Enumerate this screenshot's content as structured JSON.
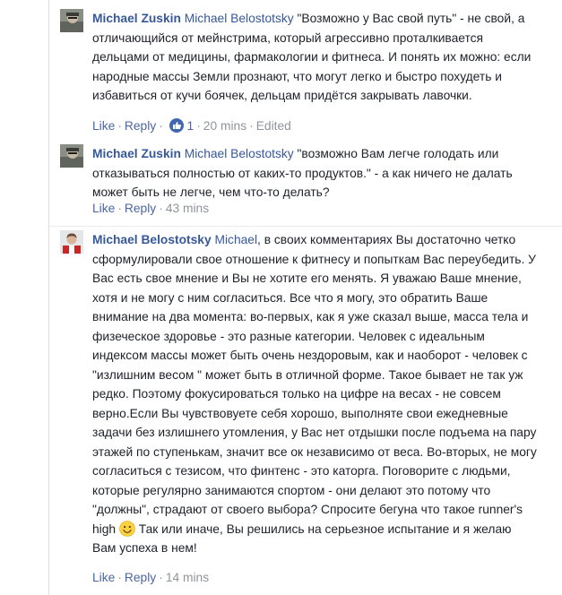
{
  "comments": [
    {
      "author": "Michael Zuskin",
      "mention": "Michael Belostotsky",
      "text": " \"Возможно у Вас свой путь\" - не свой, а отличающийся от мейнстрима, который агрессивно проталкивается дельцами от медицины, фармакологии и фитнеса. И понять их можно: если народные массы Земли прознают, что могут легко и быстро похудеть и избавиться от кучи боячек, дельцам придётся закрывать лавочки.",
      "like_label": "Like",
      "reply_label": "Reply",
      "reaction_count": "1",
      "time": "20 mins",
      "edited_label": "Edited"
    },
    {
      "author": "Michael Zuskin",
      "mention": "Michael Belostotsky",
      "text": " \"возможно Вам легче голодать или отказываться полностью от каких-то продуктов.\" - а как ничего не далать может быть не легче, чем что-то делать?",
      "like_label": "Like",
      "reply_label": "Reply",
      "time": "43 mins"
    },
    {
      "author": "Michael Belostotsky",
      "mention": "Michael",
      "text_part1": ", в своих комментариях Вы достаточно четко сформулировали свое отношение к фитнесу и попыткам Вас переубедить. У Вас есть свое мнение и Вы не хотите его менять. Я уважаю Ваше мнение, хотя и не могу с ним согласиться. Все что я могу, это обратить Ваше внимание на два момента: во-первых, как я уже сказал выше, масса тела и физеческое здоровье - это разные категории. Человек с идеальным индексом массы может быть очень нездоровым, как и наоборот - человек с \"излишним весом \" может быть в отличной форме. Такое бывает не так уж редко. Поэтому фокусироваться только на цифре на весах - не совсем верно.Если Вы чувствовуете себя хорошо, выполняте свои ежедневные задачи без излишнего утомления, у Вас нет отдышки после подъема на пару этажей по ступенькам, значит все ок независимо от веса. Во-вторых, не могу согласиться с тезисом, что финтенс - это каторга. Поговорите с людьми, которые регулярно занимаются спортом - они делают это потому что \"должны\", страдают от своего выбора? Спросите бегуна что такое runner's high",
      "text_part2": " Так или иначе, Вы решились на серьезное испытание и я желаю Вам успеха в нем!",
      "like_label": "Like",
      "reply_label": "Reply",
      "time": "14 mins"
    }
  ],
  "separator": "·",
  "colors": {
    "link": "#365899",
    "meta": "#90949c",
    "like_badge": "#4267b2"
  }
}
